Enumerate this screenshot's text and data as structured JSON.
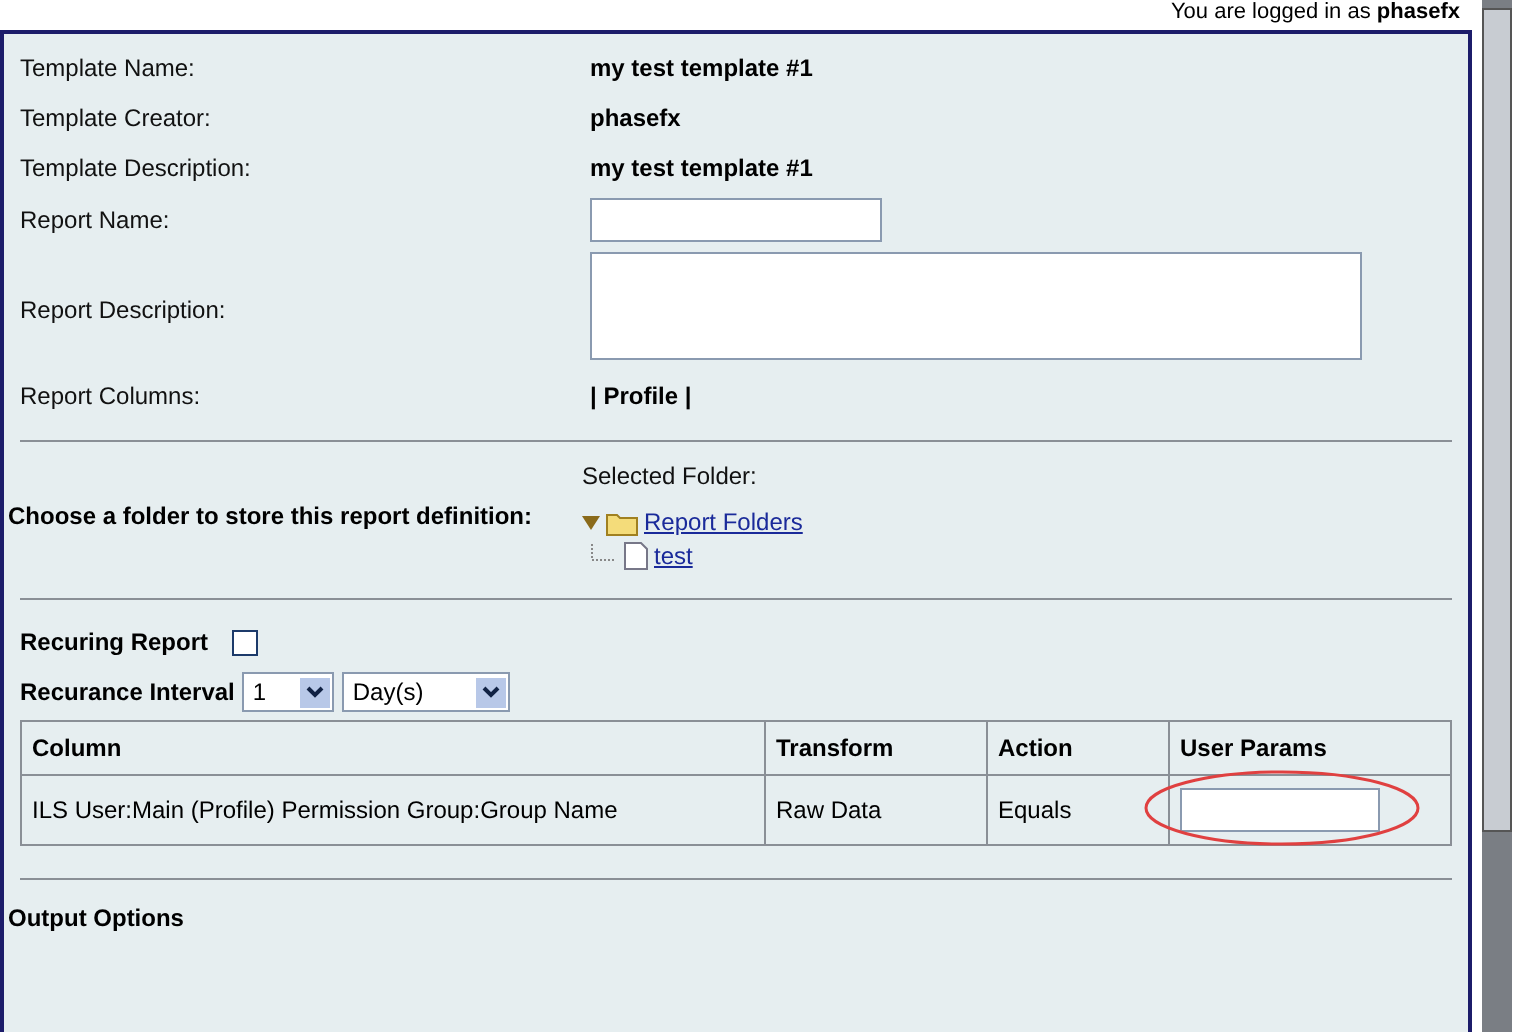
{
  "login": {
    "prefix": "You are logged in as",
    "user": "phasefx"
  },
  "fields": [
    {
      "kind": "static",
      "label": "Template Name:",
      "value": "my test template #1"
    },
    {
      "kind": "static",
      "label": "Template Creator:",
      "value": "phasefx"
    },
    {
      "kind": "static",
      "label": "Template Description:",
      "value": "my test template #1"
    },
    {
      "kind": "input",
      "label": "Report Name:"
    },
    {
      "kind": "textarea",
      "label": "Report Description:"
    },
    {
      "kind": "static",
      "label": "Report Columns:",
      "value": "| **Profile** |"
    }
  ],
  "folder": {
    "label": "Choose a folder to store this report definition:",
    "selected_label": "Selected Folder:",
    "tree": [
      {
        "label": "Report Folders",
        "expanded": true,
        "children": [
          {
            "label": "test"
          }
        ]
      }
    ]
  },
  "recurring": {
    "label": "Recuring Report",
    "checked": false
  },
  "interval": {
    "label": "Recurance Interval",
    "count": "1",
    "unit": "Day(s)"
  },
  "table": {
    "columns": [
      "Column",
      "Transform",
      "Action",
      "User Params"
    ],
    "rows": [
      {
        "column": "ILS User:Main (Profile) Permission Group:Group Name",
        "transform": "Raw Data",
        "action": "Equals",
        "highlighted": true
      }
    ]
  },
  "output_options": "Output Options"
}
